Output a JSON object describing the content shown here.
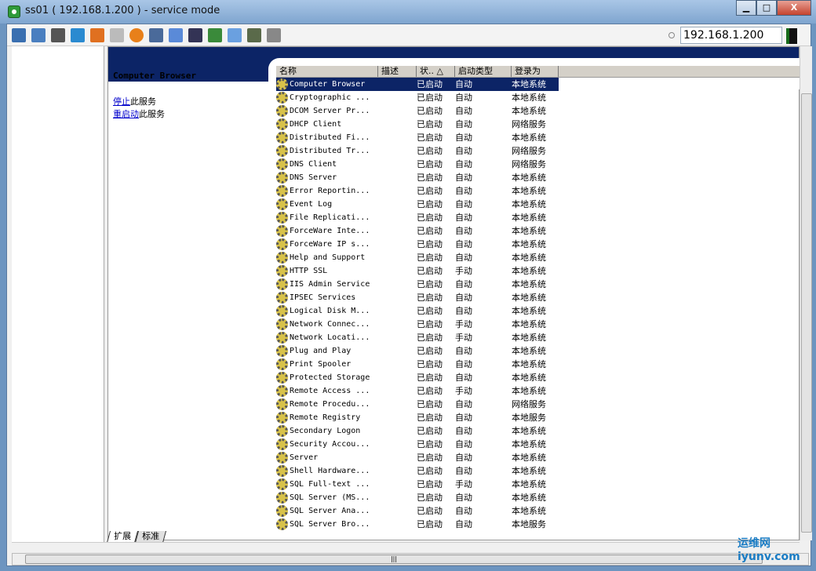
{
  "window": {
    "title": "ss01 ( 192.168.1.200 ) - service mode",
    "minimize": "▁",
    "maximize": "□",
    "close": "X"
  },
  "toolbar": {
    "ip": "192.168.1.200",
    "icons": [
      "monitor-icon",
      "windows-icon",
      "tools-icon",
      "refresh-icon",
      "windows-logo-icon",
      "keyboard-icon",
      "alert-icon",
      "disconnect-icon",
      "fullscreen-icon",
      "display-icon",
      "transfer-icon",
      "window-icon",
      "screen-icon",
      "chat-icon"
    ]
  },
  "description": {
    "title": "Computer Browser",
    "stop_link": "停止",
    "stop_suffix": "此服务",
    "restart_link": "重启动",
    "restart_suffix": "此服务"
  },
  "list": {
    "columns": [
      "名称",
      "描述",
      "状..  △",
      "启动类型",
      "登录为"
    ],
    "rows": [
      [
        "Computer Browser",
        "",
        "已启动",
        "自动",
        "本地系统"
      ],
      [
        "Cryptographic ...",
        "",
        "已启动",
        "自动",
        "本地系统"
      ],
      [
        "DCOM Server Pr...",
        "",
        "已启动",
        "自动",
        "本地系统"
      ],
      [
        "DHCP Client",
        "",
        "已启动",
        "自动",
        "网络服务"
      ],
      [
        "Distributed Fi...",
        "",
        "已启动",
        "自动",
        "本地系统"
      ],
      [
        "Distributed Tr...",
        "",
        "已启动",
        "自动",
        "网络服务"
      ],
      [
        "DNS Client",
        "",
        "已启动",
        "自动",
        "网络服务"
      ],
      [
        "DNS Server",
        "",
        "已启动",
        "自动",
        "本地系统"
      ],
      [
        "Error Reportin...",
        "",
        "已启动",
        "自动",
        "本地系统"
      ],
      [
        "Event Log",
        "",
        "已启动",
        "自动",
        "本地系统"
      ],
      [
        "File Replicati...",
        "",
        "已启动",
        "自动",
        "本地系统"
      ],
      [
        "ForceWare Inte...",
        "",
        "已启动",
        "自动",
        "本地系统"
      ],
      [
        "ForceWare IP s...",
        "",
        "已启动",
        "自动",
        "本地系统"
      ],
      [
        "Help and Support",
        "",
        "已启动",
        "自动",
        "本地系统"
      ],
      [
        "HTTP SSL",
        "",
        "已启动",
        "手动",
        "本地系统"
      ],
      [
        "IIS Admin Service",
        "",
        "已启动",
        "自动",
        "本地系统"
      ],
      [
        "IPSEC Services",
        "",
        "已启动",
        "自动",
        "本地系统"
      ],
      [
        "Logical Disk M...",
        "",
        "已启动",
        "自动",
        "本地系统"
      ],
      [
        "Network Connec...",
        "",
        "已启动",
        "手动",
        "本地系统"
      ],
      [
        "Network Locati...",
        "",
        "已启动",
        "手动",
        "本地系统"
      ],
      [
        "Plug and Play",
        "",
        "已启动",
        "自动",
        "本地系统"
      ],
      [
        "Print Spooler",
        "",
        "已启动",
        "自动",
        "本地系统"
      ],
      [
        "Protected Storage",
        "",
        "已启动",
        "自动",
        "本地系统"
      ],
      [
        "Remote Access ...",
        "",
        "已启动",
        "手动",
        "本地系统"
      ],
      [
        "Remote Procedu...",
        "",
        "已启动",
        "自动",
        "网络服务"
      ],
      [
        "Remote Registry",
        "",
        "已启动",
        "自动",
        "本地服务"
      ],
      [
        "Secondary Logon",
        "",
        "已启动",
        "自动",
        "本地系统"
      ],
      [
        "Security Accou...",
        "",
        "已启动",
        "自动",
        "本地系统"
      ],
      [
        "Server",
        "",
        "已启动",
        "自动",
        "本地系统"
      ],
      [
        "Shell Hardware...",
        "",
        "已启动",
        "自动",
        "本地系统"
      ],
      [
        "SQL Full-text ...",
        "",
        "已启动",
        "手动",
        "本地系统"
      ],
      [
        "SQL Server (MS...",
        "",
        "已启动",
        "自动",
        "本地系统"
      ],
      [
        "SQL Server Ana...",
        "",
        "已启动",
        "自动",
        "本地系统"
      ],
      [
        "SQL Server Bro...",
        "",
        "已启动",
        "自动",
        "本地服务"
      ]
    ]
  },
  "tabs": [
    "扩展",
    "标准"
  ],
  "watermark": "运维网 iyunv.com"
}
